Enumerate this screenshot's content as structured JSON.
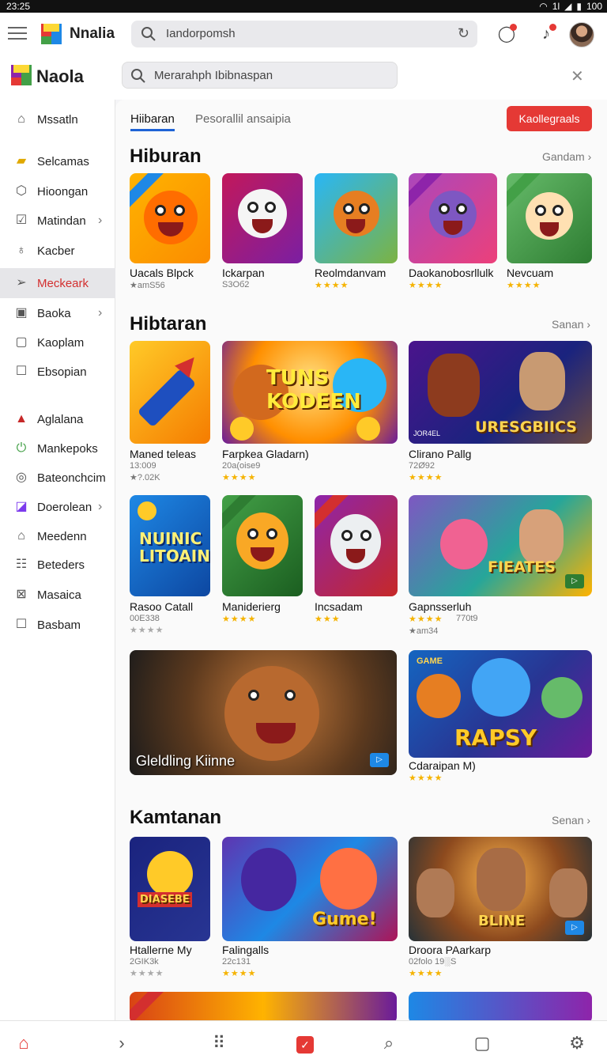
{
  "status": {
    "time": "23:25",
    "signal": "1l",
    "battery": "100"
  },
  "topbar": {
    "app_name": "Nnalia",
    "search_text": "Iandorpomsh"
  },
  "secondbar": {
    "brand": "Naola",
    "search_text": "Merarahph Ibibnaspan"
  },
  "sidebar": {
    "items": [
      {
        "label": "Mssatln",
        "icon": "tag-icon"
      },
      {
        "label": "Selcamas",
        "icon": "ticket-icon"
      },
      {
        "label": "Hioongan",
        "icon": "bag-icon"
      },
      {
        "label": "Matindan",
        "icon": "checkbox-icon"
      },
      {
        "label": "Kacber",
        "icon": "user-icon"
      },
      {
        "label": "Meckeark",
        "icon": "send-icon"
      },
      {
        "label": "Baoka",
        "icon": "grid-icon"
      },
      {
        "label": "Kaoplam",
        "icon": "square-icon"
      },
      {
        "label": "Ebsopian",
        "icon": "box-icon"
      },
      {
        "label": "Aglalana",
        "icon": "graduation-cap-icon"
      },
      {
        "label": "Mankepoks",
        "icon": "power-icon"
      },
      {
        "label": "Bateonchcim",
        "icon": "circle-icon"
      },
      {
        "label": "Doerolean",
        "icon": "purple-box-icon"
      },
      {
        "label": "Meedenn",
        "icon": "lock-icon"
      },
      {
        "label": "Beteders",
        "icon": "list-icon"
      },
      {
        "label": "Masaica",
        "icon": "image-icon"
      },
      {
        "label": "Basbam",
        "icon": "square-icon"
      }
    ]
  },
  "tabs": {
    "active": "Hiibaran",
    "other": "Pesorallil ansaipia",
    "action": "Kaollegraals"
  },
  "sections": [
    {
      "title": "Hiburan",
      "more": "Gandam"
    },
    {
      "title": "Hibtaran",
      "more": "Sanan"
    },
    {
      "title": "Kamtanan",
      "more": "Senan"
    }
  ],
  "row1": [
    {
      "name": "Uacals Blpck",
      "meta": "★amS56"
    },
    {
      "name": "Ickarpan",
      "meta": "S3Oб2"
    },
    {
      "name": "Reolmdanvam",
      "meta": ""
    },
    {
      "name": "Daokanobosrllulk",
      "meta": ""
    },
    {
      "name": "Nevcuam",
      "meta": ""
    }
  ],
  "row2": [
    {
      "name": "Maned teleas",
      "meta": "13:009",
      "meta2": "★?.02K"
    },
    {
      "name": "Farpkea Gladarn)",
      "meta": "20a(oise9"
    },
    {
      "name": "Clirano Pallg",
      "meta": "72Ø92",
      "banner": "URESGBIICS",
      "tag": "JOR4EL"
    }
  ],
  "row2_banner": "TUNS KODEEN",
  "row3": [
    {
      "name": "Rasoo Catall",
      "meta": "00E338",
      "banner": "NUINIC LITOAIN"
    },
    {
      "name": "Maniderierg",
      "meta": ""
    },
    {
      "name": "Incsadam",
      "meta": ""
    },
    {
      "name": "Gapnsserluh",
      "meta": "770t9",
      "meta2": "★am34",
      "banner": "FIEATES"
    }
  ],
  "row4": [
    {
      "name": "Gleldling Kiinne"
    },
    {
      "name": "Cdaraipan M)",
      "banner": "RAPSY",
      "tag": "GAME"
    }
  ],
  "row5": [
    {
      "name": "Htallerne My",
      "meta": "2GIK3k",
      "banner": "DIASEBE"
    },
    {
      "name": "Falingalls",
      "meta": "22c131",
      "banner": "Gume!"
    },
    {
      "name": "Droora PAarkarp",
      "meta": "02folo 19░S",
      "banner": "BLINE"
    }
  ],
  "colors": {
    "accent": "#e53935",
    "tab_underline": "#1e63d6",
    "stars": "#f5b301"
  }
}
